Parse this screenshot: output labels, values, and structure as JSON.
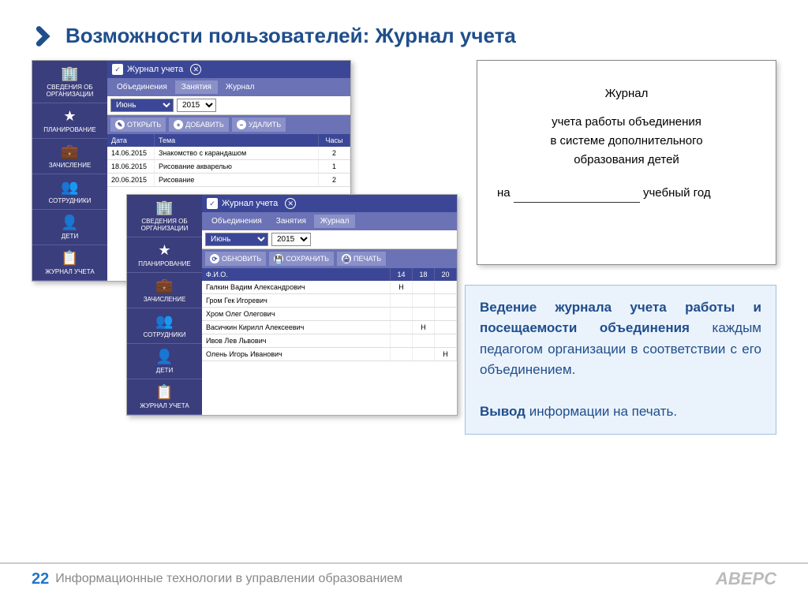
{
  "slide": {
    "title": "Возможности пользователей: Журнал учета",
    "page_num": "22",
    "footer": "Информационные технологии в управлении образованием",
    "brand": "АВЕРС"
  },
  "sidebar": {
    "items": [
      {
        "icon": "🏢",
        "label": "СВЕДЕНИЯ ОБ ОРГАНИЗАЦИИ"
      },
      {
        "icon": "★",
        "label": "ПЛАНИРОВАНИЕ"
      },
      {
        "icon": "💼",
        "label": "ЗАЧИСЛЕНИЕ"
      },
      {
        "icon": "👥",
        "label": "СОТРУДНИКИ"
      },
      {
        "icon": "👤",
        "label": "ДЕТИ"
      },
      {
        "icon": "📋",
        "label": "ЖУРНАЛ УЧЕТА"
      }
    ]
  },
  "app1": {
    "title": "Журнал учета",
    "tabs": [
      "Объединения",
      "Занятия",
      "Журнал"
    ],
    "active_tab": 1,
    "month": "Июнь",
    "year": "2015",
    "actions": {
      "open": "ОТКРЫТЬ",
      "add": "ДОБАВИТЬ",
      "del": "УДАЛИТЬ"
    },
    "columns": {
      "date": "Дата",
      "topic": "Тема",
      "hours": "Часы"
    },
    "rows": [
      {
        "date": "14.06.2015",
        "topic": "Знакомство с карандашом",
        "hours": "2"
      },
      {
        "date": "18.06.2015",
        "topic": "Рисование акварелью",
        "hours": "1"
      },
      {
        "date": "20.06.2015",
        "topic": "Рисование",
        "hours": "2"
      }
    ]
  },
  "app2": {
    "title": "Журнал учета",
    "tabs": [
      "Объединения",
      "Занятия",
      "Журнал"
    ],
    "active_tab": 2,
    "month": "Июнь",
    "year": "2015",
    "actions": {
      "refresh": "ОБНОВИТЬ",
      "save": "СОХРАНИТЬ",
      "print": "ПЕЧАТЬ"
    },
    "fio_col": "Ф.И.О.",
    "day_cols": [
      "14",
      "18",
      "20"
    ],
    "rows": [
      {
        "fio": "Галкин Вадим Александрович",
        "marks": [
          "Н",
          "",
          ""
        ]
      },
      {
        "fio": "Гром Гек Игоревич",
        "marks": [
          "",
          "",
          ""
        ]
      },
      {
        "fio": "Хром Олег Олегович",
        "marks": [
          "",
          "",
          ""
        ]
      },
      {
        "fio": "Васичкин Кирилл Алексеевич",
        "marks": [
          "",
          "Н",
          ""
        ]
      },
      {
        "fio": "Ивов Лев Львович",
        "marks": [
          "",
          "",
          ""
        ]
      },
      {
        "fio": "Олень Игорь Иванович",
        "marks": [
          "",
          "",
          "Н"
        ]
      }
    ]
  },
  "doc": {
    "line1": "Журнал",
    "line2": "учета работы объединения",
    "line3": "в системе дополнительного",
    "line4": "образования детей",
    "line5_prefix": "на",
    "line5_suffix": "учебный год"
  },
  "desc": {
    "p1_bold1": "Ведение журнала учета работы и посещаемости объединения",
    "p1_rest": " каждым педагогом организации в соответствии с его объединением.",
    "p2_bold": "Вывод",
    "p2_rest": " информации на печать."
  }
}
